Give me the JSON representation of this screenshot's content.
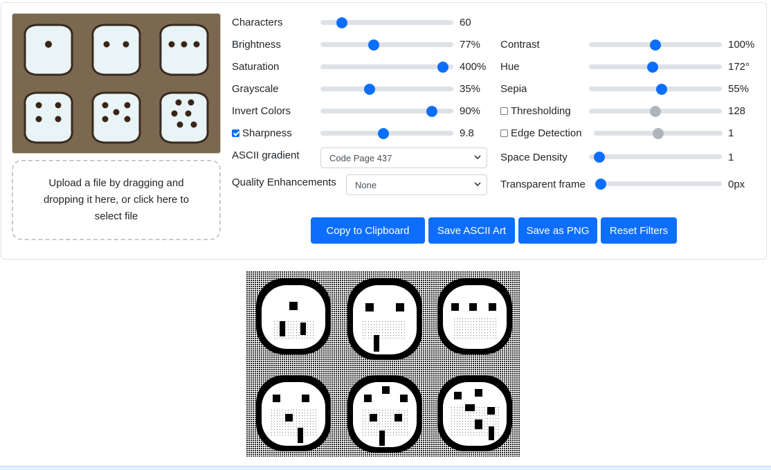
{
  "upload": {
    "text": "Upload a file by dragging and dropping it here, or click here to select file"
  },
  "controls": {
    "characters": {
      "label": "Characters",
      "value": "60",
      "level": 0.13
    },
    "brightness": {
      "label": "Brightness",
      "value": "77%",
      "level": 0.39
    },
    "saturation": {
      "label": "Saturation",
      "value": "400%",
      "level": 0.96
    },
    "grayscale": {
      "label": "Grayscale",
      "value": "35%",
      "level": 0.36
    },
    "invert": {
      "label": "Invert Colors",
      "value": "90%",
      "level": 0.87
    },
    "sharpness": {
      "label": "Sharpness",
      "value": "9.8",
      "level": 0.47,
      "checked": true
    },
    "contrast": {
      "label": "Contrast",
      "value": "100%",
      "level": 0.5
    },
    "hue": {
      "label": "Hue",
      "value": "172°",
      "level": 0.48
    },
    "sepia": {
      "label": "Sepia",
      "value": "55%",
      "level": 0.55
    },
    "thresholding": {
      "label": "Thresholding",
      "value": "128",
      "level": 0.5,
      "checked": false
    },
    "edge": {
      "label": "Edge Detection",
      "value": "1",
      "level": 0.5,
      "checked": false
    },
    "space_density": {
      "label": "Space Density",
      "value": "1",
      "level": 0.04
    },
    "transparent_frame": {
      "label": "Transparent frame",
      "value": "0px",
      "level": 0.0
    }
  },
  "gradient": {
    "label": "ASCII gradient",
    "selected": "Code Page 437"
  },
  "quality": {
    "label": "Quality Enhancements",
    "selected": "None"
  },
  "buttons": {
    "copy": "Copy to Clipboard",
    "save_ascii": "Save ASCII Art",
    "save_png": "Save as PNG",
    "reset": "Reset Filters"
  },
  "colors": {
    "accent": "#0d6efd",
    "track": "#dee2e6",
    "disabled": "#adb5bd"
  }
}
